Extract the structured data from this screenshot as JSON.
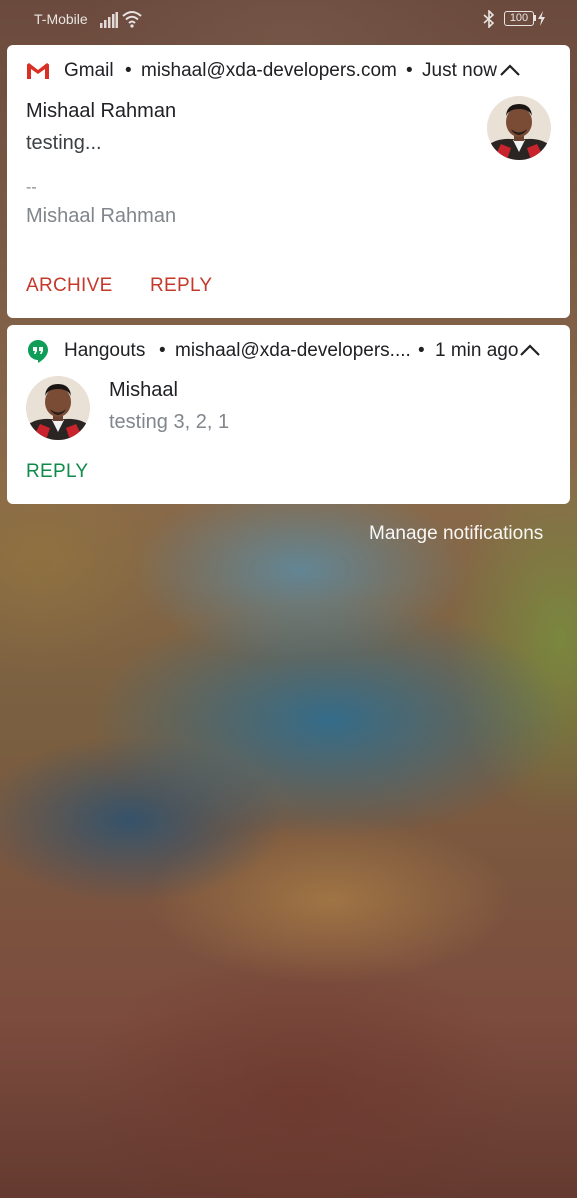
{
  "status_bar": {
    "carrier": "T-Mobile",
    "battery_level": "100",
    "icons": [
      "signal-icon",
      "wifi-icon",
      "bluetooth-icon",
      "battery-icon",
      "charging-icon"
    ]
  },
  "gmail_notification": {
    "app_name": "Gmail",
    "separator": "•",
    "account": "mishaal@xda-developers.com",
    "time": "Just now",
    "sender": "Mishaal Rahman",
    "message": "testing...",
    "signature_dashes": "--",
    "signature_name": "Mishaal Rahman",
    "actions": {
      "archive": "ARCHIVE",
      "reply": "REPLY"
    },
    "accent_color": "#c5392b",
    "icons": [
      "gmail-icon",
      "collapse-icon"
    ]
  },
  "hangouts_notification": {
    "app_name": "Hangouts",
    "separator": "•",
    "account": "mishaal@xda-developers....",
    "time": "1 min ago",
    "sender": "Mishaal",
    "message": "testing 3, 2, 1",
    "actions": {
      "reply": "REPLY"
    },
    "accent_color": "#0f8a4a",
    "icons": [
      "hangouts-icon",
      "collapse-icon"
    ]
  },
  "manage_notifications": "Manage notifications"
}
